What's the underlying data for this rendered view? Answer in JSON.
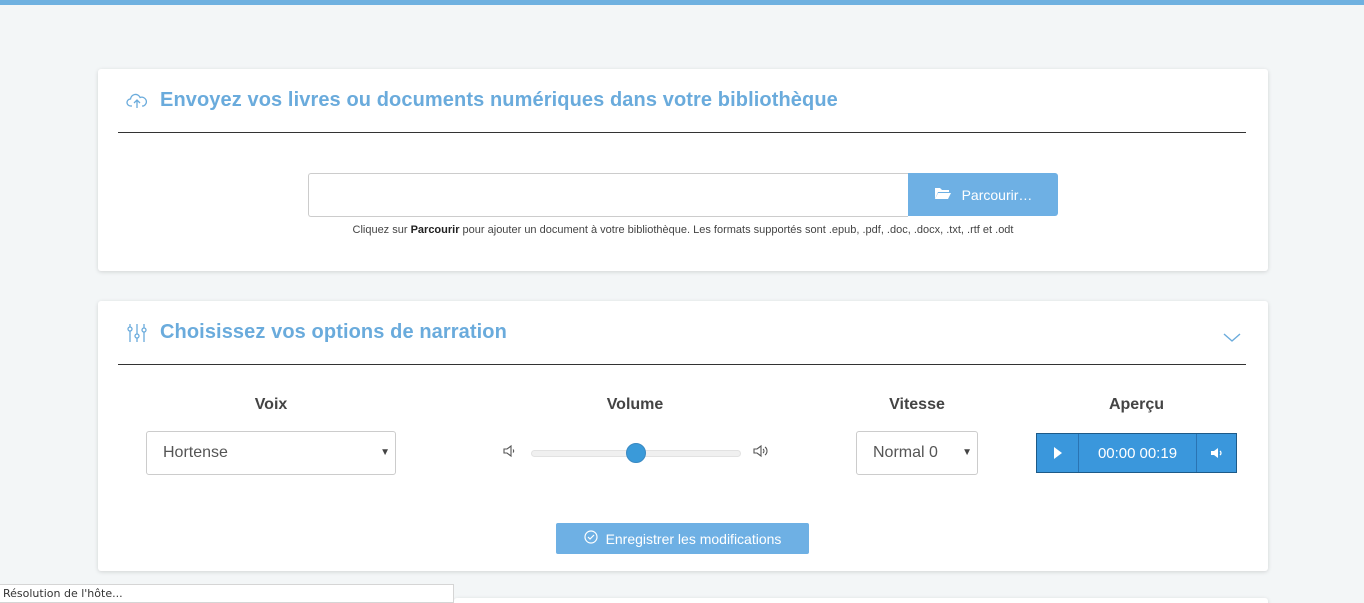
{
  "upload": {
    "title": "Envoyez vos livres ou documents numériques dans votre bibliothèque",
    "file_value": "",
    "browse_label": "Parcourir…",
    "help_prefix": "Cliquez sur ",
    "help_bold": "Parcourir",
    "help_suffix": " pour ajouter un document à votre bibliothèque. Les formats supportés sont .epub, .pdf, .doc, .docx, .txt, .rtf et .odt"
  },
  "options": {
    "title": "Choisissez vos options de narration",
    "voice_label": "Voix",
    "voice_value": "Hortense",
    "volume_label": "Volume",
    "volume_level": 0.5,
    "speed_label": "Vitesse",
    "speed_value": "Normal 0",
    "preview_label": "Aperçu",
    "player_current": "00:00",
    "player_duration": "00:19",
    "save_label": "Enregistrer les modifications"
  },
  "status_bar": {
    "text": "Résolution de l'hôte..."
  },
  "colors": {
    "accent": "#6aabdc",
    "button": "#6eb0e4",
    "player": "#3a97dc",
    "top_bar": "#6fb1e0"
  }
}
